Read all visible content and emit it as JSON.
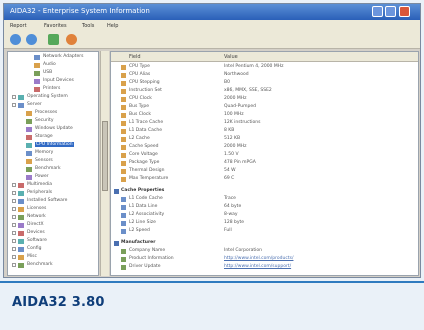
{
  "caption": "AIDA32 3.80",
  "window": {
    "title": "AIDA32 - Enterprise System Information",
    "colors": {
      "titlebar": "#2a5fb8",
      "selection": "#316ac5",
      "caption_text": "#0f3e7a",
      "caption_rule": "#2f7bbf"
    }
  },
  "menu": [
    "Report",
    "Favorites",
    "Tools",
    "Help"
  ],
  "toolbar": {
    "icons": [
      "back-icon",
      "forward-icon",
      "refresh-icon",
      "report-icon"
    ]
  },
  "tree": [
    {
      "label": "Network Adapters",
      "indent": 2,
      "icon": "network"
    },
    {
      "label": "Audio",
      "indent": 2,
      "icon": "audio"
    },
    {
      "label": "USB",
      "indent": 2,
      "icon": "usb"
    },
    {
      "label": "Input Devices",
      "indent": 2,
      "icon": "input"
    },
    {
      "label": "Printers",
      "indent": 2,
      "icon": "printer"
    },
    {
      "label": "Operating System",
      "indent": 0,
      "icon": "os",
      "expander": "+"
    },
    {
      "label": "Server",
      "indent": 0,
      "icon": "server",
      "expander": "-"
    },
    {
      "label": "Processes",
      "indent": 1,
      "icon": "proc"
    },
    {
      "label": "Security",
      "indent": 1,
      "icon": "sec"
    },
    {
      "label": "Windows Update",
      "indent": 1,
      "icon": "upd"
    },
    {
      "label": "Storage",
      "indent": 1,
      "icon": "stor"
    },
    {
      "label": "CPU Information",
      "indent": 1,
      "icon": "cpu",
      "selected": true
    },
    {
      "label": "Memory",
      "indent": 1,
      "icon": "mem"
    },
    {
      "label": "Sensors",
      "indent": 1,
      "icon": "sens"
    },
    {
      "label": "Benchmark",
      "indent": 1,
      "icon": "bench"
    },
    {
      "label": "Power",
      "indent": 1,
      "icon": "pwr"
    },
    {
      "label": "Multimedia",
      "indent": 0,
      "icon": "mm",
      "expander": "+"
    },
    {
      "label": "Peripherals",
      "indent": 0,
      "icon": "per",
      "expander": "+"
    },
    {
      "label": "Installed Software",
      "indent": 0,
      "icon": "sw",
      "expander": "+"
    },
    {
      "label": "Licenses",
      "indent": 0,
      "icon": "lic",
      "expander": "+"
    },
    {
      "label": "Network",
      "indent": 0,
      "icon": "net",
      "expander": "+"
    },
    {
      "label": "DirectX",
      "indent": 0,
      "icon": "dx",
      "expander": "+"
    },
    {
      "label": "Devices",
      "indent": 0,
      "icon": "dev",
      "expander": "+"
    },
    {
      "label": "Software",
      "indent": 0,
      "icon": "sw2",
      "expander": "+"
    },
    {
      "label": "Config",
      "indent": 0,
      "icon": "cfg",
      "expander": "+"
    },
    {
      "label": "Misc",
      "indent": 0,
      "icon": "misc",
      "expander": "+"
    },
    {
      "label": "Benchmark",
      "indent": 0,
      "icon": "bm",
      "expander": "+"
    }
  ],
  "columns": [
    "Field",
    "Value"
  ],
  "props": [
    {
      "field": "CPU Type",
      "value": "Intel Pentium 4, 2000 MHz",
      "icon": "#d9a14b"
    },
    {
      "field": "CPU Alias",
      "value": "Northwood",
      "icon": "#d9a14b"
    },
    {
      "field": "CPU Stepping",
      "value": "B0",
      "icon": "#d9a14b"
    },
    {
      "field": "Instruction Set",
      "value": "x86, MMX, SSE, SSE2",
      "icon": "#d9a14b"
    },
    {
      "field": "CPU Clock",
      "value": "2000 MHz",
      "icon": "#d9a14b"
    },
    {
      "field": "Bus Type",
      "value": "Quad-Pumped",
      "icon": "#d9a14b"
    },
    {
      "field": "Bus Clock",
      "value": "100 MHz",
      "icon": "#d9a14b"
    },
    {
      "field": "L1 Trace Cache",
      "value": "12K instructions",
      "icon": "#d9a14b"
    },
    {
      "field": "L1 Data Cache",
      "value": "8 KB",
      "icon": "#d9a14b"
    },
    {
      "field": "L2 Cache",
      "value": "512 KB",
      "icon": "#d9a14b"
    },
    {
      "field": "Cache Speed",
      "value": "2000 MHz",
      "icon": "#d9a14b"
    },
    {
      "field": "Core Voltage",
      "value": "1.50 V",
      "icon": "#d9a14b"
    },
    {
      "field": "Package Type",
      "value": "478 Pin mPGA",
      "icon": "#d9a14b"
    },
    {
      "field": "Thermal Design",
      "value": "54 W",
      "icon": "#d9a14b"
    },
    {
      "field": "Max Temperature",
      "value": "69 C",
      "icon": "#d9a14b"
    },
    {
      "group": "Cache Properties"
    },
    {
      "field": "L1 Code Cache",
      "value": "Trace",
      "icon": "#6b8fc9"
    },
    {
      "field": "L1 Data Line",
      "value": "64 byte",
      "icon": "#6b8fc9"
    },
    {
      "field": "L2 Associativity",
      "value": "8-way",
      "icon": "#6b8fc9"
    },
    {
      "field": "L2 Line Size",
      "value": "128 byte",
      "icon": "#6b8fc9"
    },
    {
      "field": "L2 Speed",
      "value": "Full",
      "icon": "#6b8fc9"
    },
    {
      "group": "Manufacturer"
    },
    {
      "field": "Company Name",
      "value": "Intel Corporation",
      "icon": "#7a9f5a"
    },
    {
      "field": "Product Information",
      "value": "http://www.intel.com/products/",
      "icon": "#7a9f5a",
      "link": true
    },
    {
      "field": "Driver Update",
      "value": "http://www.intel.com/support/",
      "icon": "#7a9f5a",
      "link": true
    }
  ]
}
